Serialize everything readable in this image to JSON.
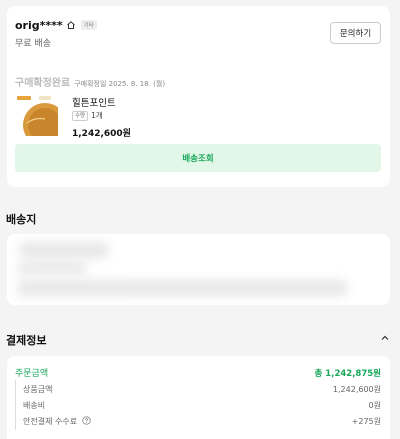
{
  "order": {
    "seller_name": "orig****",
    "badge": "기타",
    "shipping_type": "무료 배송",
    "inquiry_label": "문의하기",
    "status": "구매확정완료",
    "confirm_date": "구매확정일 2025. 8. 18. (월)",
    "product_name": "힐튼포인트",
    "qty_badge": "수량",
    "qty": "1개",
    "price": "1,242,600원",
    "tracking_label": "배송조회"
  },
  "address": {
    "title": "배송지"
  },
  "payment": {
    "title": "결제정보",
    "order_amount_label": "주문금액",
    "order_amount_value": "총 1,242,875원",
    "items": [
      {
        "label": "상품금액",
        "value": "1,242,600원"
      },
      {
        "label": "배송비",
        "value": "0원"
      },
      {
        "label": "안전결제 수수료",
        "value": "+275원"
      }
    ]
  },
  "colors": {
    "accent_green": "#19a85a",
    "tracking_bg": "#e2f7e8",
    "page_bg": "#f4f4f4"
  },
  "icons": [
    "home-icon",
    "chevron-up-icon",
    "help-circle-icon"
  ]
}
